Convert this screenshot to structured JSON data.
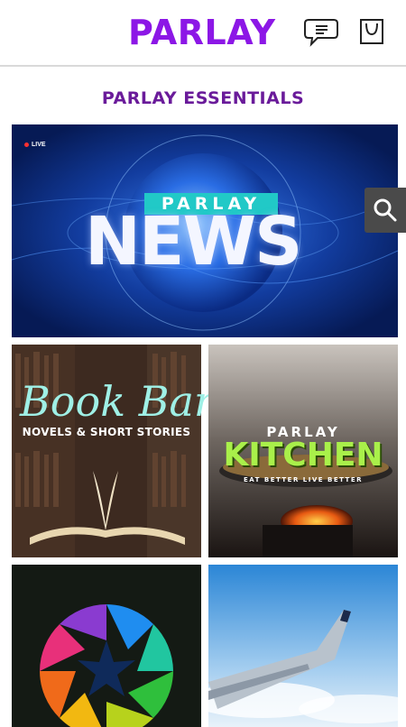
{
  "header": {
    "brand": "PARLAY",
    "chat_icon": "chat-bubble-icon",
    "bag_icon": "shopping-bag-icon"
  },
  "section": {
    "title": "PARLAY ESSENTIALS"
  },
  "tiles": {
    "news": {
      "live": "LIVE",
      "banner": "PARLAY",
      "title": "NEWS"
    },
    "book": {
      "title": "Book Bar",
      "subtitle": "NOVELS & SHORT STORIES"
    },
    "kitchen": {
      "brand": "PARLAY",
      "title": "KITCHEN",
      "tagline": "EAT BETTER LIVE BETTER"
    },
    "circle": {},
    "travel": {}
  },
  "search": {
    "icon": "search-icon"
  },
  "colors": {
    "brand": "#8c17e6",
    "section_title": "#6a1b9a",
    "news_banner": "#21c9c7",
    "kitchen_green": "#a9f04a"
  }
}
